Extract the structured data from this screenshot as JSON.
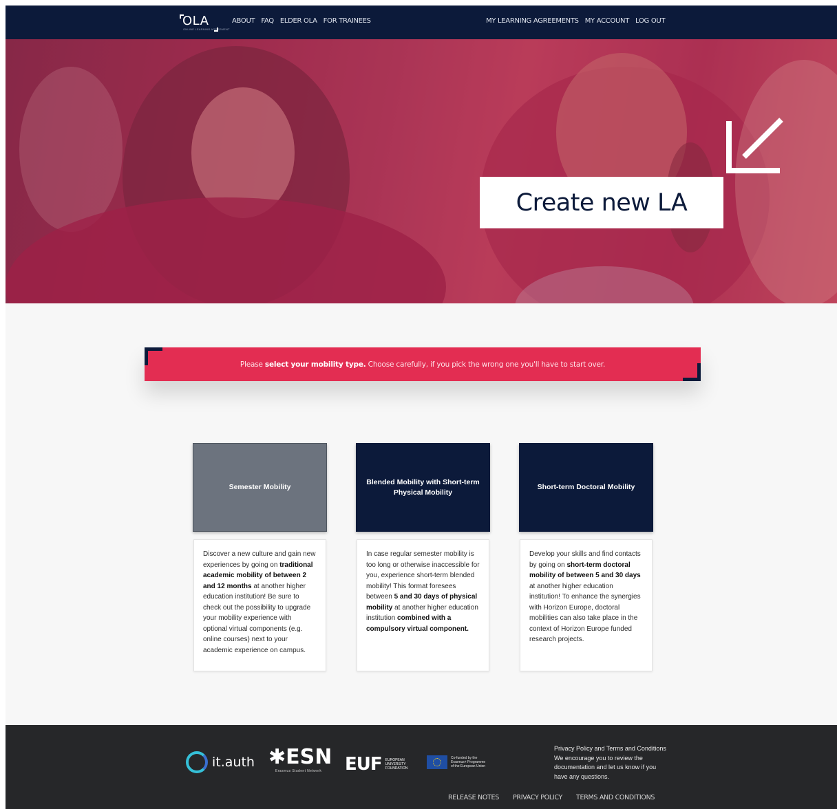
{
  "nav": {
    "logo_text": "OLA",
    "logo_subtitle": "ONLINE LEARNING AGREEMENT",
    "left_links": [
      "ABOUT",
      "FAQ",
      "ELDER OLA",
      "FOR TRAINEES"
    ],
    "right_links": [
      "MY LEARNING AGREEMENTS",
      "MY ACCOUNT",
      "LOG OUT"
    ]
  },
  "hero": {
    "cta_label": "Create new LA",
    "icon": "arrow-down-left-icon"
  },
  "banner": {
    "prefix": "Please ",
    "strong": "select your mobility type.",
    "suffix": " Choose carefully, if you pick the wrong one you'll have to start over."
  },
  "options": [
    {
      "title": "Semester Mobility",
      "desc": [
        "Discover a new culture and gain new experiences by going on ",
        "traditional academic mobility of between 2 and 12 months",
        " at another higher education institution! Be sure to check out the possibility to upgrade your mobility experience with optional virtual components (e.g. online courses) next to your academic experience on campus."
      ]
    },
    {
      "title": "Blended Mobility with Short-term Physical Mobility",
      "desc": [
        "In case regular semester mobility is too long or otherwise inaccessible for you, experience short-term blended mobility! This format foresees between ",
        "5 and 30 days of physical mobility",
        " at another higher education institution ",
        "combined with a compulsory virtual component."
      ]
    },
    {
      "title": "Short-term Doctoral Mobility",
      "desc": [
        "Develop your skills and find contacts by going on ",
        "short-term doctoral mobility of between 5 and 30 days",
        " at another higher education institution! To enhance the synergies with Horizon Europe, doctoral mobilities can also take place in the context of Horizon Europe funded research projects."
      ]
    }
  ],
  "footer": {
    "logos": {
      "itauth": "it.auth",
      "esn": "✱ESN",
      "esn_sub": "Erasmus Student Network",
      "euf": "EUF",
      "euf_sub": [
        "EUROPEAN",
        "UNIVERSITY",
        "FOUNDATION"
      ],
      "eu_sub": [
        "Co-funded by the",
        "Erasmus+ Programme",
        "of the European Union"
      ]
    },
    "text": "Privacy Policy and Terms and Conditions We encourage you to review the documentation and let us know if you have any questions.",
    "links": [
      "RELEASE NOTES",
      "PRIVACY POLICY",
      "TERMS AND CONDITIONS"
    ]
  },
  "colors": {
    "navy": "#0c1a3a",
    "accent_red": "#e32d52",
    "selected_grey": "#6c737e",
    "footer": "#262729"
  }
}
